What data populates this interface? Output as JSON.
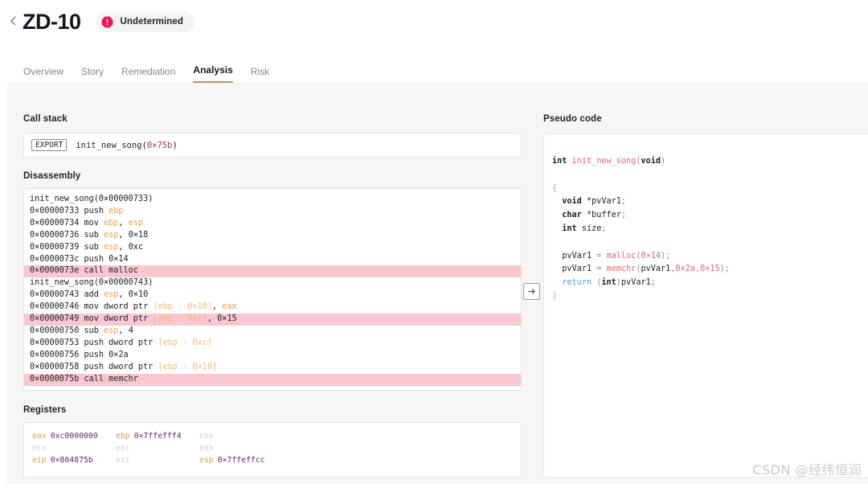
{
  "header": {
    "back_icon": "chevron-left-icon",
    "title": "ZD-10",
    "status": {
      "icon": "alert-octagon-icon",
      "label": "Undetermined",
      "icon_color": "#e8175d",
      "pill_bg": "#f4f4f5"
    }
  },
  "tabs": {
    "active_index": 3,
    "accent_color": "#b79a68",
    "items": [
      {
        "label": "Overview"
      },
      {
        "label": "Story"
      },
      {
        "label": "Remediation"
      },
      {
        "label": "Analysis"
      },
      {
        "label": "Risk"
      }
    ]
  },
  "call_stack": {
    "label": "Call stack",
    "entry": {
      "tag": "EXPORT",
      "fn_name": "init_new_song",
      "open_paren": "(",
      "arg": "0×75b",
      "close_paren": ")"
    }
  },
  "disassembly": {
    "label": "Disassembly",
    "highlight_color": "#f9c6d2",
    "lines": [
      {
        "type": "header",
        "text": "init_new_song(0×00000733)",
        "highlight": false
      },
      {
        "type": "insn",
        "addr": "0×00000733",
        "mnemonic": "push",
        "operands": [
          {
            "t": "reg",
            "v": "ebp"
          }
        ],
        "highlight": false
      },
      {
        "type": "insn",
        "addr": "0×00000734",
        "mnemonic": "mov",
        "operands": [
          {
            "t": "reg",
            "v": "ebp"
          },
          {
            "t": "sep",
            "v": ", "
          },
          {
            "t": "reg",
            "v": "esp"
          }
        ],
        "highlight": false
      },
      {
        "type": "insn",
        "addr": "0×00000736",
        "mnemonic": "sub",
        "operands": [
          {
            "t": "reg",
            "v": "esp"
          },
          {
            "t": "sep",
            "v": ", "
          },
          {
            "t": "num",
            "v": "0×18"
          }
        ],
        "highlight": false
      },
      {
        "type": "insn",
        "addr": "0×00000739",
        "mnemonic": "sub",
        "operands": [
          {
            "t": "reg",
            "v": "esp"
          },
          {
            "t": "sep",
            "v": ", "
          },
          {
            "t": "num",
            "v": "0xc"
          }
        ],
        "highlight": false
      },
      {
        "type": "insn",
        "addr": "0×0000073c",
        "mnemonic": "push",
        "operands": [
          {
            "t": "num",
            "v": "0×14"
          }
        ],
        "highlight": false
      },
      {
        "type": "insn",
        "addr": "0×0000073e",
        "mnemonic": "call malloc",
        "operands": [],
        "highlight": true
      },
      {
        "type": "header",
        "text": "init_new_song(0×00000743)",
        "highlight": false
      },
      {
        "type": "insn",
        "addr": "0×00000743",
        "mnemonic": "add",
        "operands": [
          {
            "t": "reg",
            "v": "esp"
          },
          {
            "t": "sep",
            "v": ", "
          },
          {
            "t": "num",
            "v": "0×10"
          }
        ],
        "highlight": false
      },
      {
        "type": "insn",
        "addr": "0×00000746",
        "mnemonic": "mov dword ptr",
        "operands": [
          {
            "t": "mem",
            "v": "[ebp - 0×10]"
          },
          {
            "t": "sep",
            "v": ", "
          },
          {
            "t": "reg",
            "v": "eax"
          }
        ],
        "highlight": false
      },
      {
        "type": "insn",
        "addr": "0×00000749",
        "mnemonic": "mov dword ptr",
        "operands": [
          {
            "t": "mem",
            "v": "[ebp - 0xc]"
          },
          {
            "t": "sep",
            "v": ", "
          },
          {
            "t": "num",
            "v": "0×15"
          }
        ],
        "highlight": true
      },
      {
        "type": "insn",
        "addr": "0×00000750",
        "mnemonic": "sub",
        "operands": [
          {
            "t": "reg",
            "v": "esp"
          },
          {
            "t": "sep",
            "v": ", "
          },
          {
            "t": "num",
            "v": "4"
          }
        ],
        "highlight": false
      },
      {
        "type": "insn",
        "addr": "0×00000753",
        "mnemonic": "push dword ptr",
        "operands": [
          {
            "t": "mem",
            "v": "[ebp - 0xc]"
          }
        ],
        "highlight": false
      },
      {
        "type": "insn",
        "addr": "0×00000756",
        "mnemonic": "push",
        "operands": [
          {
            "t": "num",
            "v": "0×2a"
          }
        ],
        "highlight": false
      },
      {
        "type": "insn",
        "addr": "0×00000758",
        "mnemonic": "push dword ptr",
        "operands": [
          {
            "t": "mem",
            "v": "[ebp - 0×10]"
          }
        ],
        "highlight": false
      },
      {
        "type": "insn",
        "addr": "0×0000075b",
        "mnemonic": "call memchr",
        "operands": [],
        "highlight": true
      }
    ]
  },
  "registers": {
    "label": "Registers",
    "rows": [
      [
        {
          "name": "eax",
          "value": "0xc0000000"
        },
        {
          "name": "ebp",
          "value": "0×7ffefff4"
        },
        {
          "name": "ebx",
          "value": ""
        }
      ],
      [
        {
          "name": "ecx",
          "value": ""
        },
        {
          "name": "edi",
          "value": ""
        },
        {
          "name": "edx",
          "value": ""
        }
      ],
      [
        {
          "name": "eip",
          "value": "0×804875b"
        },
        {
          "name": "esi",
          "value": ""
        },
        {
          "name": "esp",
          "value": "0×7ffeffcc"
        }
      ]
    ]
  },
  "transfer_button": {
    "icon": "arrow-right-in-box-icon"
  },
  "pseudo_code": {
    "label": "Pseudo code",
    "lines": [
      [
        {
          "t": "kw",
          "v": "int"
        },
        {
          "t": "sp",
          "v": " "
        },
        {
          "t": "fn",
          "v": "init_new_song"
        },
        {
          "t": "punct",
          "v": "("
        },
        {
          "t": "kw",
          "v": "void"
        },
        {
          "t": "punct",
          "v": ")"
        }
      ],
      [],
      [
        {
          "t": "brace",
          "v": "{"
        }
      ],
      [
        {
          "t": "sp",
          "v": "  "
        },
        {
          "t": "kw",
          "v": "void"
        },
        {
          "t": "sp",
          "v": " "
        },
        {
          "t": "var",
          "v": "*pvVar1"
        },
        {
          "t": "punct",
          "v": ";"
        }
      ],
      [
        {
          "t": "sp",
          "v": "  "
        },
        {
          "t": "kw",
          "v": "char"
        },
        {
          "t": "sp",
          "v": " "
        },
        {
          "t": "var",
          "v": "*buffer"
        },
        {
          "t": "punct",
          "v": ";"
        }
      ],
      [
        {
          "t": "sp",
          "v": "  "
        },
        {
          "t": "kw",
          "v": "int"
        },
        {
          "t": "sp",
          "v": " "
        },
        {
          "t": "var",
          "v": "size"
        },
        {
          "t": "punct",
          "v": ";"
        }
      ],
      [],
      [
        {
          "t": "sp",
          "v": "  "
        },
        {
          "t": "var",
          "v": "pvVar1"
        },
        {
          "t": "punct",
          "v": " = "
        },
        {
          "t": "call",
          "v": "malloc"
        },
        {
          "t": "punct",
          "v": "("
        },
        {
          "t": "call",
          "v": "0×14"
        },
        {
          "t": "punct",
          "v": ");"
        }
      ],
      [
        {
          "t": "sp",
          "v": "  "
        },
        {
          "t": "var",
          "v": "pvVar1"
        },
        {
          "t": "punct",
          "v": " = "
        },
        {
          "t": "call",
          "v": "memchr"
        },
        {
          "t": "punct",
          "v": "("
        },
        {
          "t": "var",
          "v": "pvVar1"
        },
        {
          "t": "punct",
          "v": ","
        },
        {
          "t": "call",
          "v": "0×2a"
        },
        {
          "t": "punct",
          "v": ","
        },
        {
          "t": "call",
          "v": "0×15"
        },
        {
          "t": "punct",
          "v": ");"
        }
      ],
      [
        {
          "t": "sp",
          "v": "  "
        },
        {
          "t": "ret",
          "v": "return"
        },
        {
          "t": "sp",
          "v": " "
        },
        {
          "t": "punct",
          "v": "("
        },
        {
          "t": "kw",
          "v": "int"
        },
        {
          "t": "punct",
          "v": ")"
        },
        {
          "t": "var",
          "v": "pvVar1"
        },
        {
          "t": "punct",
          "v": ";"
        }
      ],
      [
        {
          "t": "brace",
          "v": "}"
        }
      ]
    ]
  },
  "watermark": {
    "text": "CSDN @经纬恒润"
  }
}
